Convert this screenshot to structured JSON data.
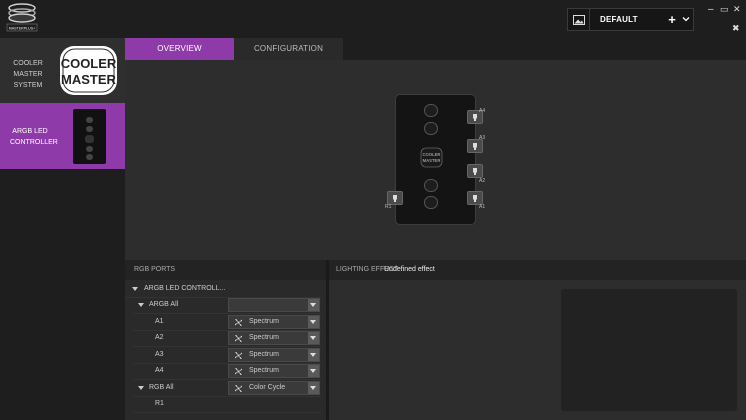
{
  "app": {
    "logo_text": "MASTERPLUS+",
    "profile": {
      "name": "DEFAULT",
      "plus": "+",
      "chevron": "⌄"
    },
    "window_controls": {
      "minimize": "–",
      "maximize": "▭",
      "close": "✕",
      "tools": "✖"
    }
  },
  "sidebar": {
    "devices": [
      {
        "label": "COOLER MASTER SYSTEM",
        "logo_text": "COOLER MASTER"
      },
      {
        "label": "ARGB LED CONTROLLER"
      }
    ]
  },
  "tabs": [
    {
      "label": "OVERVIEW",
      "active": true
    },
    {
      "label": "CONFIGURATION",
      "active": false
    }
  ],
  "device": {
    "brand": "COOLER MASTER",
    "ports": [
      {
        "label": "A4"
      },
      {
        "label": "A3"
      },
      {
        "label": "A2"
      },
      {
        "label": "A1"
      },
      {
        "label": "R1"
      }
    ]
  },
  "rgb_ports": {
    "title": "RGB PORTS",
    "tree": [
      {
        "name": "ARGB LED CONTROLL...",
        "level": 0,
        "expanded": true
      },
      {
        "name": "ARGB All",
        "level": 1,
        "expanded": true,
        "effect": ""
      },
      {
        "name": "A1",
        "level": 2,
        "effect": "Spectrum"
      },
      {
        "name": "A2",
        "level": 2,
        "effect": "Spectrum"
      },
      {
        "name": "A3",
        "level": 2,
        "effect": "Spectrum"
      },
      {
        "name": "A4",
        "level": 2,
        "effect": "Spectrum"
      },
      {
        "name": "RGB All",
        "level": 1,
        "expanded": true,
        "effect": "Color Cycle"
      },
      {
        "name": "R1",
        "level": 2
      }
    ]
  },
  "lighting": {
    "label": "LIGHTING EFFECT",
    "value": "Undefined effect"
  },
  "colors": {
    "accent": "#8e3aa8",
    "background": "#2b2b2b",
    "panel": "#1e1e1e"
  }
}
